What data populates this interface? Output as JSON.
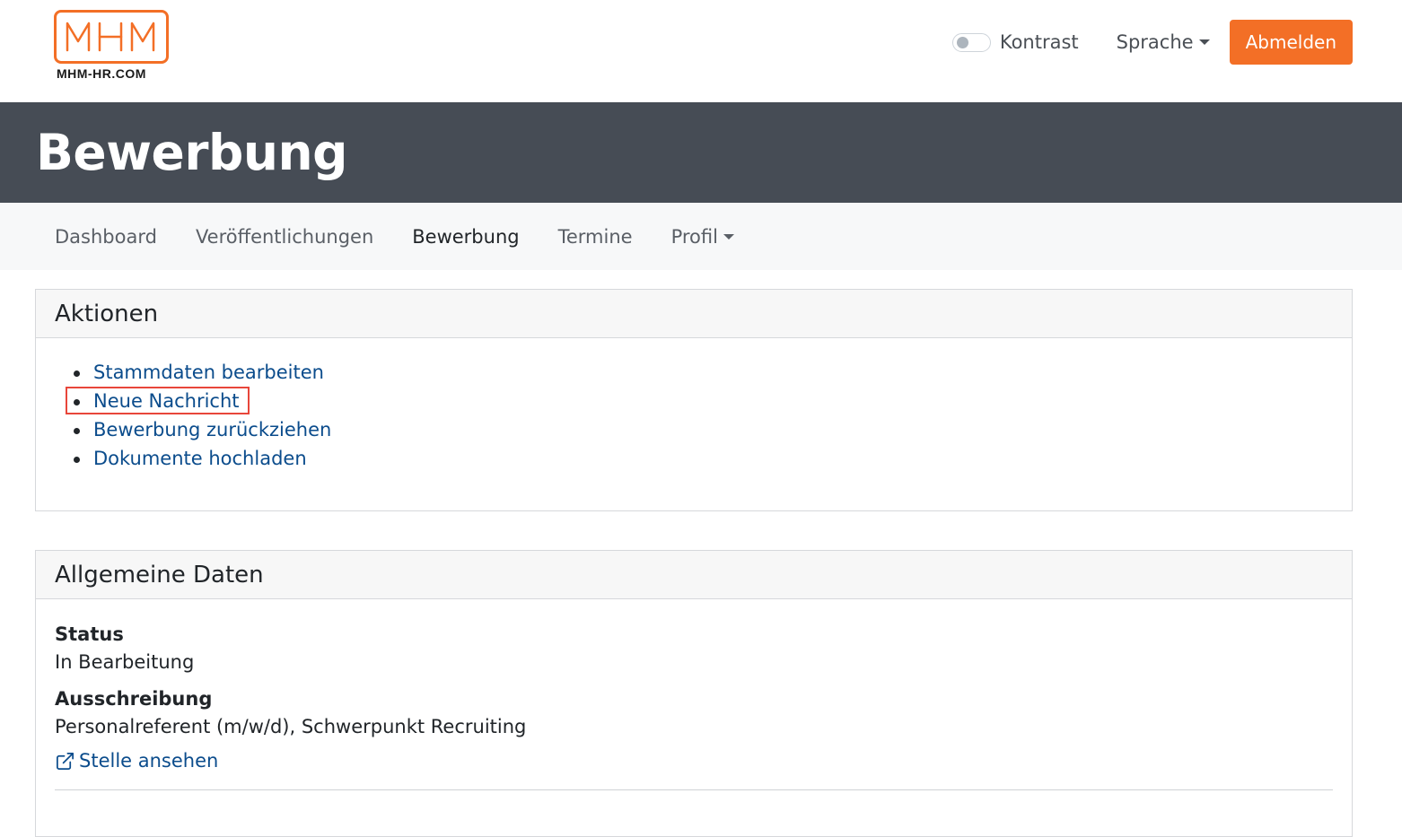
{
  "header": {
    "logo_text": "MHM",
    "logo_url": "MHM-HR.COM",
    "contrast_label": "Kontrast",
    "language_label": "Sprache",
    "logout_label": "Abmelden",
    "accent_color": "#f36f26"
  },
  "banner": {
    "title": "Bewerbung",
    "background_color": "#464c55"
  },
  "nav": {
    "items": [
      {
        "label": "Dashboard",
        "active": false
      },
      {
        "label": "Veröffentlichungen",
        "active": false
      },
      {
        "label": "Bewerbung",
        "active": true
      },
      {
        "label": "Termine",
        "active": false
      },
      {
        "label": "Profil",
        "active": false,
        "dropdown": true
      }
    ]
  },
  "actions": {
    "title": "Aktionen",
    "items": [
      {
        "label": "Stammdaten bearbeiten"
      },
      {
        "label": "Neue Nachricht",
        "highlighted": true
      },
      {
        "label": "Bewerbung zurückziehen"
      },
      {
        "label": "Dokumente hochladen"
      }
    ]
  },
  "general": {
    "title": "Allgemeine Daten",
    "status_label": "Status",
    "status_value": "In Bearbeitung",
    "posting_label": "Ausschreibung",
    "posting_value": "Personalreferent (m/w/d), Schwerpunkt Recruiting",
    "view_link": "Stelle ansehen",
    "link_icon": "external-link-icon"
  }
}
